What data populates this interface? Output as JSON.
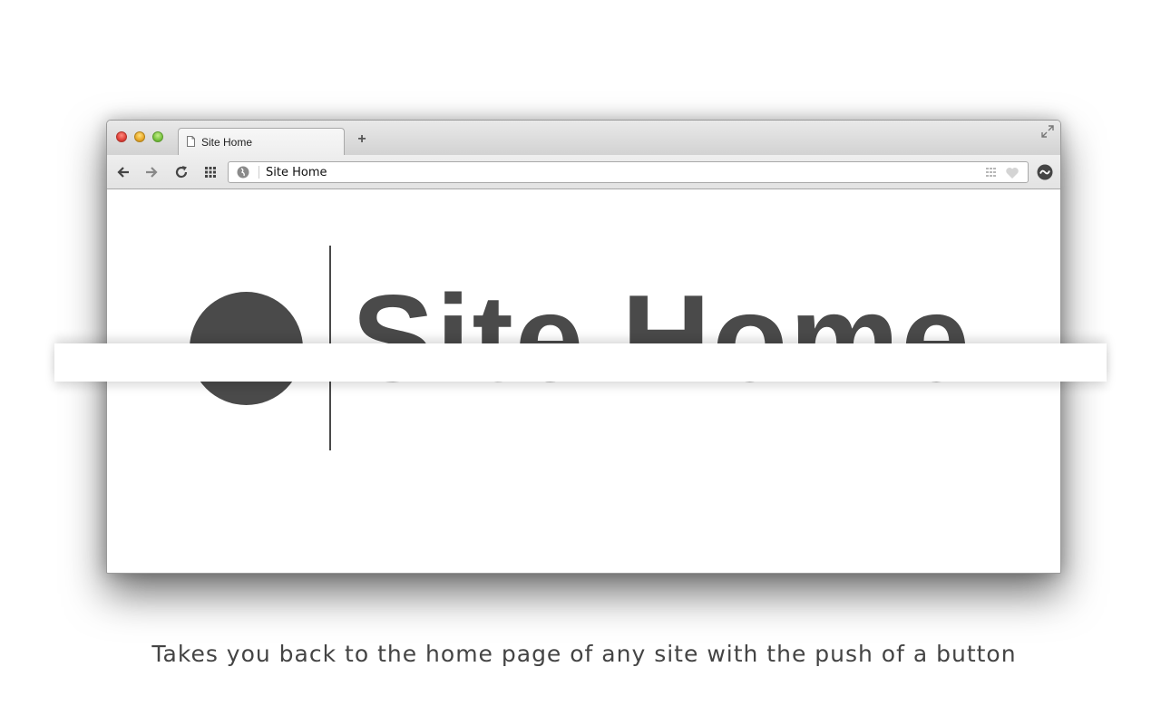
{
  "browser": {
    "tab": {
      "title": "Site Home",
      "icon": "page-icon"
    },
    "new_tab_symbol": "+",
    "omnibox": {
      "text": "Site Home"
    },
    "toolbar_icons": [
      "back-arrow-icon",
      "forward-arrow-icon",
      "reload-icon",
      "apps-grid-icon"
    ],
    "extension_icon": "site-home-extension-icon"
  },
  "page": {
    "logo_text": "Site Home"
  },
  "caption": "Takes you back to the home page of any site with the push of a button",
  "colors": {
    "logo": "#4a4a4a",
    "caption": "#444444"
  }
}
